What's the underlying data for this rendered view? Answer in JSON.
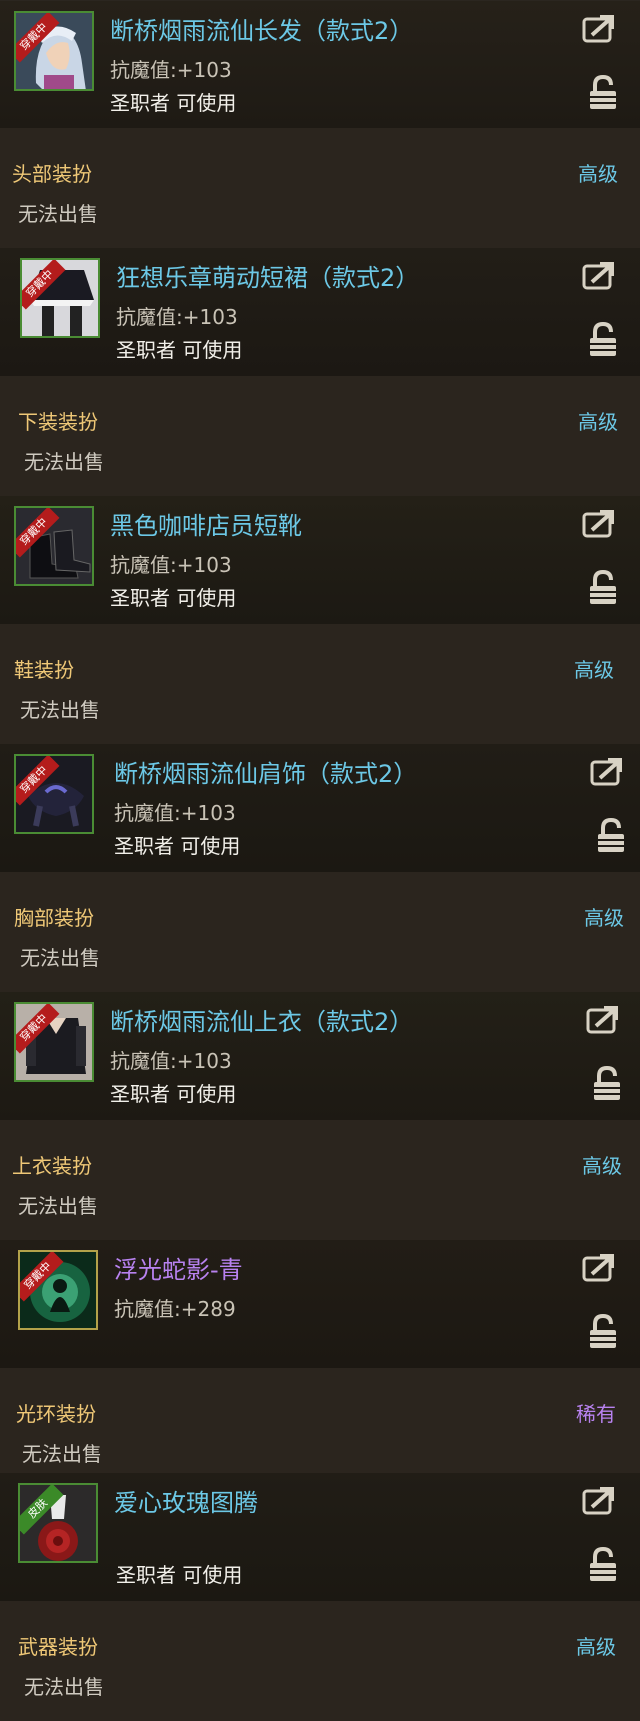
{
  "items": [
    {
      "name": "断桥烟雨流仙长发（款式2）",
      "stat_label": "抗魔值:",
      "stat_value": "+103",
      "usable": "圣职者 可使用",
      "badge": "穿戴中",
      "slot": "头部装扮",
      "grade": "高级",
      "sell": "无法出售",
      "icon": "hair-icon"
    },
    {
      "name": "狂想乐章萌动短裙（款式2）",
      "stat_label": "抗魔值:",
      "stat_value": "+103",
      "usable": "圣职者 可使用",
      "badge": "穿戴中",
      "slot": "下装装扮",
      "grade": "高级",
      "sell": "无法出售",
      "icon": "skirt-icon"
    },
    {
      "name": "黑色咖啡店员短靴",
      "stat_label": "抗魔值:",
      "stat_value": "+103",
      "usable": "圣职者 可使用",
      "badge": "穿戴中",
      "slot": "鞋装扮",
      "grade": "高级",
      "sell": "无法出售",
      "icon": "boots-icon"
    },
    {
      "name": "断桥烟雨流仙肩饰（款式2）",
      "stat_label": "抗魔值:",
      "stat_value": "+103",
      "usable": "圣职者 可使用",
      "badge": "穿戴中",
      "slot": "胸部装扮",
      "grade": "高级",
      "sell": "无法出售",
      "icon": "shoulder-icon"
    },
    {
      "name": "断桥烟雨流仙上衣（款式2）",
      "stat_label": "抗魔值:",
      "stat_value": "+103",
      "usable": "圣职者 可使用",
      "badge": "穿戴中",
      "slot": "上衣装扮",
      "grade": "高级",
      "sell": "无法出售",
      "icon": "top-icon"
    },
    {
      "name": "浮光蛇影-青",
      "stat_label": "抗魔值:",
      "stat_value": "+289",
      "usable": "",
      "badge": "穿戴中",
      "slot": "光环装扮",
      "grade": "稀有",
      "sell": "无法出售",
      "icon": "aura-icon"
    },
    {
      "name": "爱心玫瑰图腾",
      "stat_label": "",
      "stat_value": "",
      "usable": "圣职者 可使用",
      "badge": "皮肤",
      "slot": "武器装扮",
      "grade": "高级",
      "sell": "无法出售",
      "icon": "rose-icon"
    }
  ],
  "colors": {
    "name": "#6cc8e6",
    "rare": "#b882f0",
    "slot": "#efc877",
    "worn_badge": "#b41c1c",
    "skin_badge": "#3b8a28"
  }
}
